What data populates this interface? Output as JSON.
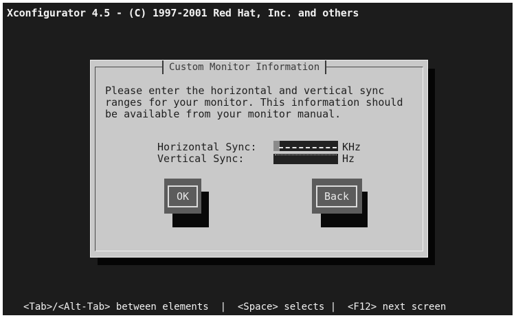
{
  "app": {
    "title": "Xconfigurator 4.5 - (C) 1997-2001 Red Hat, Inc. and others"
  },
  "dialog": {
    "title": "Custom Monitor Information",
    "message_lines": [
      "Please enter the horizontal and vertical sync",
      "ranges for your monitor. This information should",
      "be available from your monitor manual."
    ],
    "fields": {
      "horizontal": {
        "label": "Horizontal Sync:",
        "value": "",
        "unit": "KHz"
      },
      "vertical": {
        "label": "Vertical Sync:",
        "value": "",
        "unit": "Hz"
      }
    },
    "buttons": {
      "ok": "OK",
      "back": "Back"
    }
  },
  "help_bar": {
    "text": "<Tab>/<Alt-Tab> between elements  |  <Space> selects |  <F12> next screen"
  },
  "colors": {
    "screen_background": "#1c1c1c",
    "dialog_background": "#c9c9c9",
    "button_background": "#5c5c5c",
    "text_dark": "#1f1f1f",
    "text_light": "#f2f2f2"
  }
}
